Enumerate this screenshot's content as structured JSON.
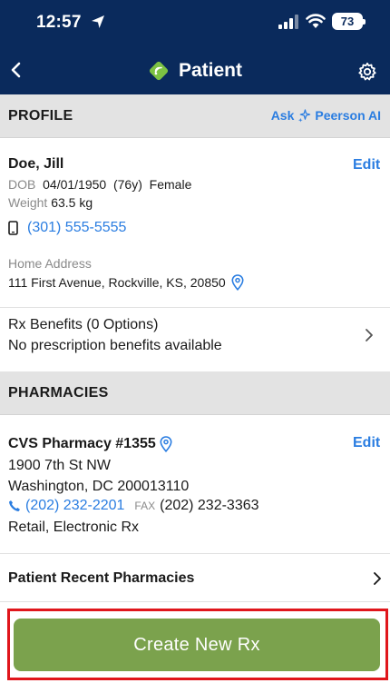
{
  "status_bar": {
    "time": "12:57",
    "battery": "73"
  },
  "nav": {
    "title": "Patient"
  },
  "profile_section": {
    "title": "PROFILE",
    "ask_prefix": "Ask",
    "ask_suffix": "Peerson AI"
  },
  "patient": {
    "name": "Doe, Jill",
    "edit_label": "Edit",
    "dob_label": "DOB",
    "dob": "04/01/1950",
    "age": "(76y)",
    "sex": "Female",
    "weight_label": "Weight",
    "weight": "63.5 kg",
    "phone": "(301) 555-5555",
    "address_label": "Home Address",
    "address": "111 First Avenue, Rockville, KS, 20850"
  },
  "benefits": {
    "title": "Rx Benefits (0 Options)",
    "subtitle": "No prescription benefits available"
  },
  "pharmacies_section": {
    "title": "PHARMACIES"
  },
  "pharmacy": {
    "name": "CVS Pharmacy #1355",
    "edit_label": "Edit",
    "street": "1900 7th St NW",
    "city_line": "Washington, DC 200013110",
    "phone": "(202) 232-2201",
    "fax_label": "FAX",
    "fax": "(202) 232-3363",
    "type": "Retail, Electronic Rx"
  },
  "recent_pharmacies": {
    "label": "Patient Recent Pharmacies"
  },
  "cta": {
    "label": "Create New Rx"
  },
  "colors": {
    "nav_bg": "#0a2a5c",
    "link": "#2a7de1",
    "cta_bg": "#7ba24d",
    "highlight_border": "#e0161c",
    "logo_green": "#7cc243"
  },
  "icons": [
    "location-arrow-icon",
    "signal-icon",
    "wifi-icon",
    "battery-icon",
    "back-chevron-icon",
    "app-logo-icon",
    "gear-icon",
    "sparkle-icon",
    "mobile-phone-icon",
    "map-pin-icon",
    "chevron-right-icon",
    "phone-icon"
  ]
}
